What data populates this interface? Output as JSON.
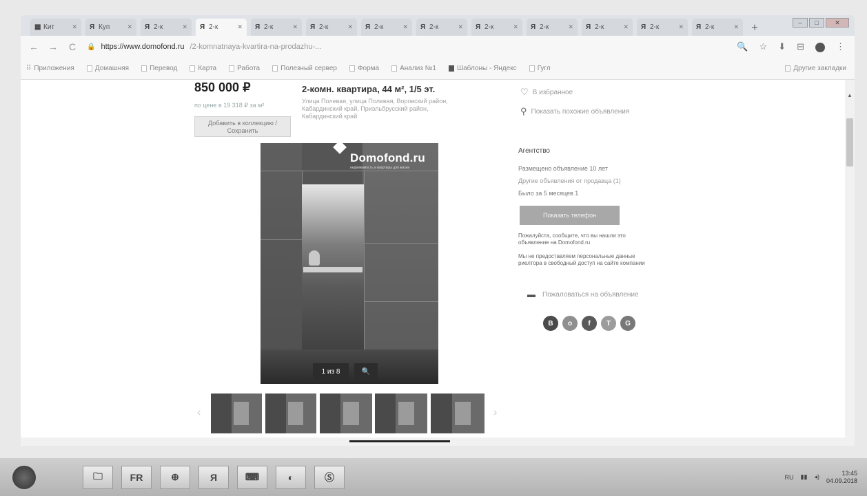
{
  "window": {
    "controls": [
      "–",
      "□",
      "✕"
    ]
  },
  "tabs": [
    {
      "favicon": "▦",
      "label": "Кит",
      "active": false
    },
    {
      "favicon": "Я",
      "label": "Куп",
      "active": false
    },
    {
      "favicon": "Я",
      "label": "2-к",
      "active": false
    },
    {
      "favicon": "Я",
      "label": "2-к",
      "active": true
    },
    {
      "favicon": "Я",
      "label": "2-к",
      "active": false
    },
    {
      "favicon": "Я",
      "label": "2-к",
      "active": false
    },
    {
      "favicon": "Я",
      "label": "2-к",
      "active": false
    },
    {
      "favicon": "Я",
      "label": "2-к",
      "active": false
    },
    {
      "favicon": "Я",
      "label": "2-к",
      "active": false
    },
    {
      "favicon": "Я",
      "label": "2-к",
      "active": false
    },
    {
      "favicon": "Я",
      "label": "2-к",
      "active": false
    },
    {
      "favicon": "Я",
      "label": "2-к",
      "active": false
    },
    {
      "favicon": "Я",
      "label": "2-к",
      "active": false
    }
  ],
  "newtab_label": "+",
  "toolbar": {
    "back": "←",
    "forward": "→",
    "reload": "C",
    "lock": "🔒",
    "url_host": "https://www.domofond.ru",
    "url_path": "/2-komnatnaya-kvartira-na-prodazhu-...",
    "icons": [
      "🔍",
      "☆",
      "⬇",
      "⊟",
      "⋮"
    ]
  },
  "bookmarks": {
    "apps_label": "Приложения",
    "items": [
      "Домашняя",
      "Перевод",
      "Карта",
      "Работа",
      "Полезный сервер",
      "Форма",
      "Анализ №1",
      "Шаблоны - Яндекс",
      "Гугл"
    ],
    "other_label": "Другие закладки"
  },
  "listing": {
    "price": "850 000 ₽",
    "price_per_m2": "по цене в 19 318 ₽ за м²",
    "collection_button": "Добавить в коллекцию / Сохранить",
    "title": "2-комн. квартира, 44 м², 1/5 эт.",
    "address": "Улица Полевая, улица Полевая, Воровский район, Кабардинский край, Приэльбрусский район, Кабардинский край",
    "favorite_link": "В избранное",
    "similar_link": "Показать похожие объявления"
  },
  "contact": {
    "label": "Агентство",
    "line1": "Размещено объявление 10 лет",
    "line2": "Другие объявления от продавца (1)",
    "line3": "Было за 5 месяцев 1",
    "phone_button": "Показать телефон",
    "note1": "Пожалуйста, сообщите, что вы нашли это объявление на Domofond.ru",
    "note2": "Мы не предоставляем персональные данные риелтора в свободный доступ на сайте компании",
    "complain": "Пожаловаться на объявление"
  },
  "photo": {
    "logo": "Domofond.ru",
    "logo_sub": "недвижимость и квартиры для жизни",
    "counter": "1 из 8",
    "zoom_icon": "🔍"
  },
  "thumbs_prev": "‹",
  "thumbs_next": "›",
  "socials": [
    {
      "glyph": "В",
      "color": "#4a4a4a"
    },
    {
      "glyph": "о",
      "color": "#8f8f8f"
    },
    {
      "glyph": "f",
      "color": "#595959"
    },
    {
      "glyph": "Т",
      "color": "#9c9c9c"
    },
    {
      "glyph": "G",
      "color": "#787878"
    }
  ],
  "taskbar": {
    "apps": [
      "",
      "🗀",
      "FR",
      "⊕",
      "Я",
      "⌨",
      "◐",
      "Ⓢ"
    ],
    "tray": "RU",
    "clock_time": "13:45",
    "clock_date": "04.09.2018"
  }
}
